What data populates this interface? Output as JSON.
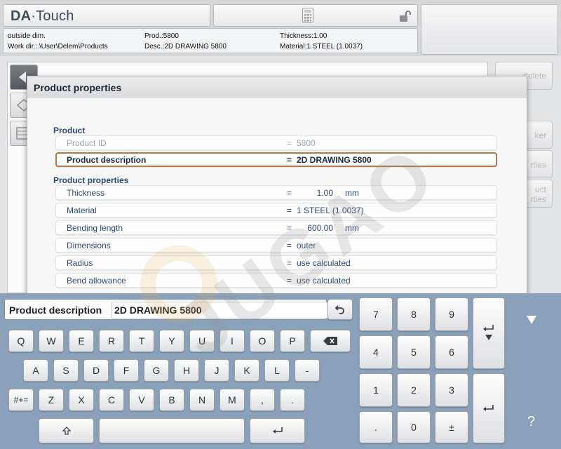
{
  "app": {
    "logo_bold": "DA",
    "logo_rest": "·Touch"
  },
  "info": {
    "mode": "outside dim.",
    "work_dir": "Work dir.: \\User\\Delem\\Products",
    "prod": "Prod.:5800",
    "desc": "Desc.:2D DRAWING 5800",
    "thickness": "Thickness:1.00",
    "material": "Material:1 STEEL (1.0037)"
  },
  "side_buttons": {
    "delete": "delete",
    "marker": "ker",
    "properties": "rties",
    "product_a": "uct",
    "product_b": "rties"
  },
  "dialog": {
    "title": "Product properties",
    "sections": [
      {
        "title": "Product"
      },
      {
        "title": "Product properties"
      }
    ],
    "rows": [
      {
        "label": "Product ID",
        "eq": "=",
        "value": "5800",
        "unit": ""
      },
      {
        "label": "Product description",
        "eq": "=",
        "value": "2D DRAWING 5800",
        "unit": ""
      },
      {
        "label": "Thickness",
        "eq": "=",
        "value": "1.00",
        "unit": "mm"
      },
      {
        "label": "Material",
        "eq": "=",
        "value": "1 STEEL (1.0037)",
        "unit": ""
      },
      {
        "label": "Bending length",
        "eq": "=",
        "value": "600.00",
        "unit": "mm"
      },
      {
        "label": "Dimensions",
        "eq": "=",
        "value": "outer",
        "unit": ""
      },
      {
        "label": "Radius",
        "eq": "=",
        "value": "use calculated",
        "unit": ""
      },
      {
        "label": "Bend allowance",
        "eq": "=",
        "value": "use calculated",
        "unit": ""
      }
    ]
  },
  "keyboard": {
    "field_label": "Product description",
    "field_value": "2D DRAWING 5800",
    "row1": [
      "Q",
      "W",
      "E",
      "R",
      "T",
      "Y",
      "U",
      "I",
      "O",
      "P"
    ],
    "row2": [
      "A",
      "S",
      "D",
      "F",
      "G",
      "H",
      "J",
      "K",
      "L",
      "-"
    ],
    "row3": [
      "Z",
      "X",
      "C",
      "V",
      "B",
      "N",
      "M",
      ",",
      "."
    ],
    "symbols_key": "#+=",
    "numpad": [
      "7",
      "8",
      "9",
      "4",
      "5",
      "6",
      "1",
      "2",
      "3",
      ".",
      "0",
      "±"
    ],
    "help": "?"
  },
  "watermark": "JUGAO",
  "colors": {
    "accent": "#2a4a78",
    "selection": "#b67845",
    "keyboard_bg": "#8ba1ba"
  }
}
